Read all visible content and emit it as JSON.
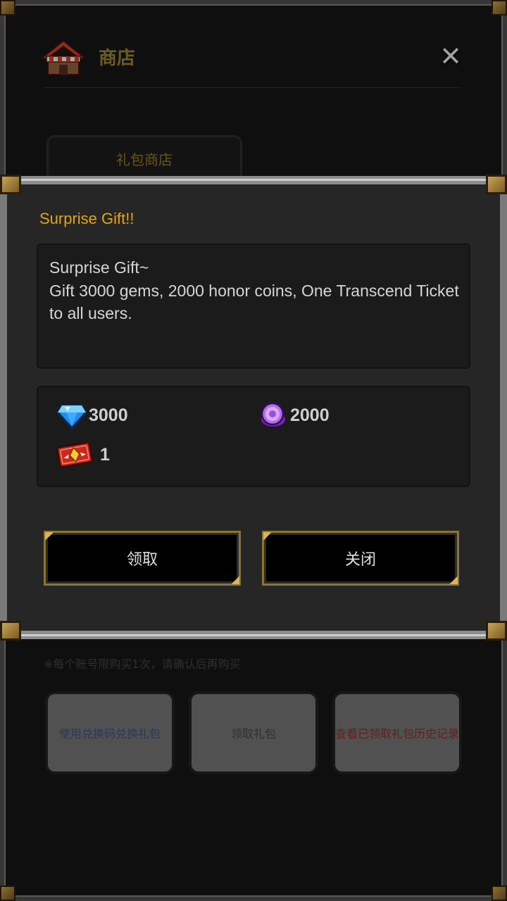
{
  "background_window": {
    "title": "商店",
    "close_icon": "close-icon",
    "tab_label": "礼包商店",
    "note": "※每个账号限购买1次，请确认后再购买",
    "buttons": [
      {
        "label": "使用兑换码兑换礼包",
        "color": "#3a4a7a"
      },
      {
        "label": "领取礼包",
        "color": "#404040"
      },
      {
        "label": "查看已领取礼包历史记录",
        "color": "#7a2f2a"
      }
    ]
  },
  "popup": {
    "title": "Surprise Gift!!",
    "message_lines": [
      "Surprise Gift~",
      "Gift 3000 gems, 2000 honor coins, One Transcend Ticket",
      "to all users."
    ],
    "rewards": [
      {
        "icon": "gem-icon",
        "amount": "3000"
      },
      {
        "icon": "honor-coin-icon",
        "amount": "2000"
      },
      {
        "icon": "transcend-ticket-icon",
        "amount": "1"
      }
    ],
    "confirm_label": "领取",
    "cancel_label": "关闭"
  },
  "colors": {
    "title_gold": "#e3a516",
    "frame_gold": "#b8944a"
  }
}
